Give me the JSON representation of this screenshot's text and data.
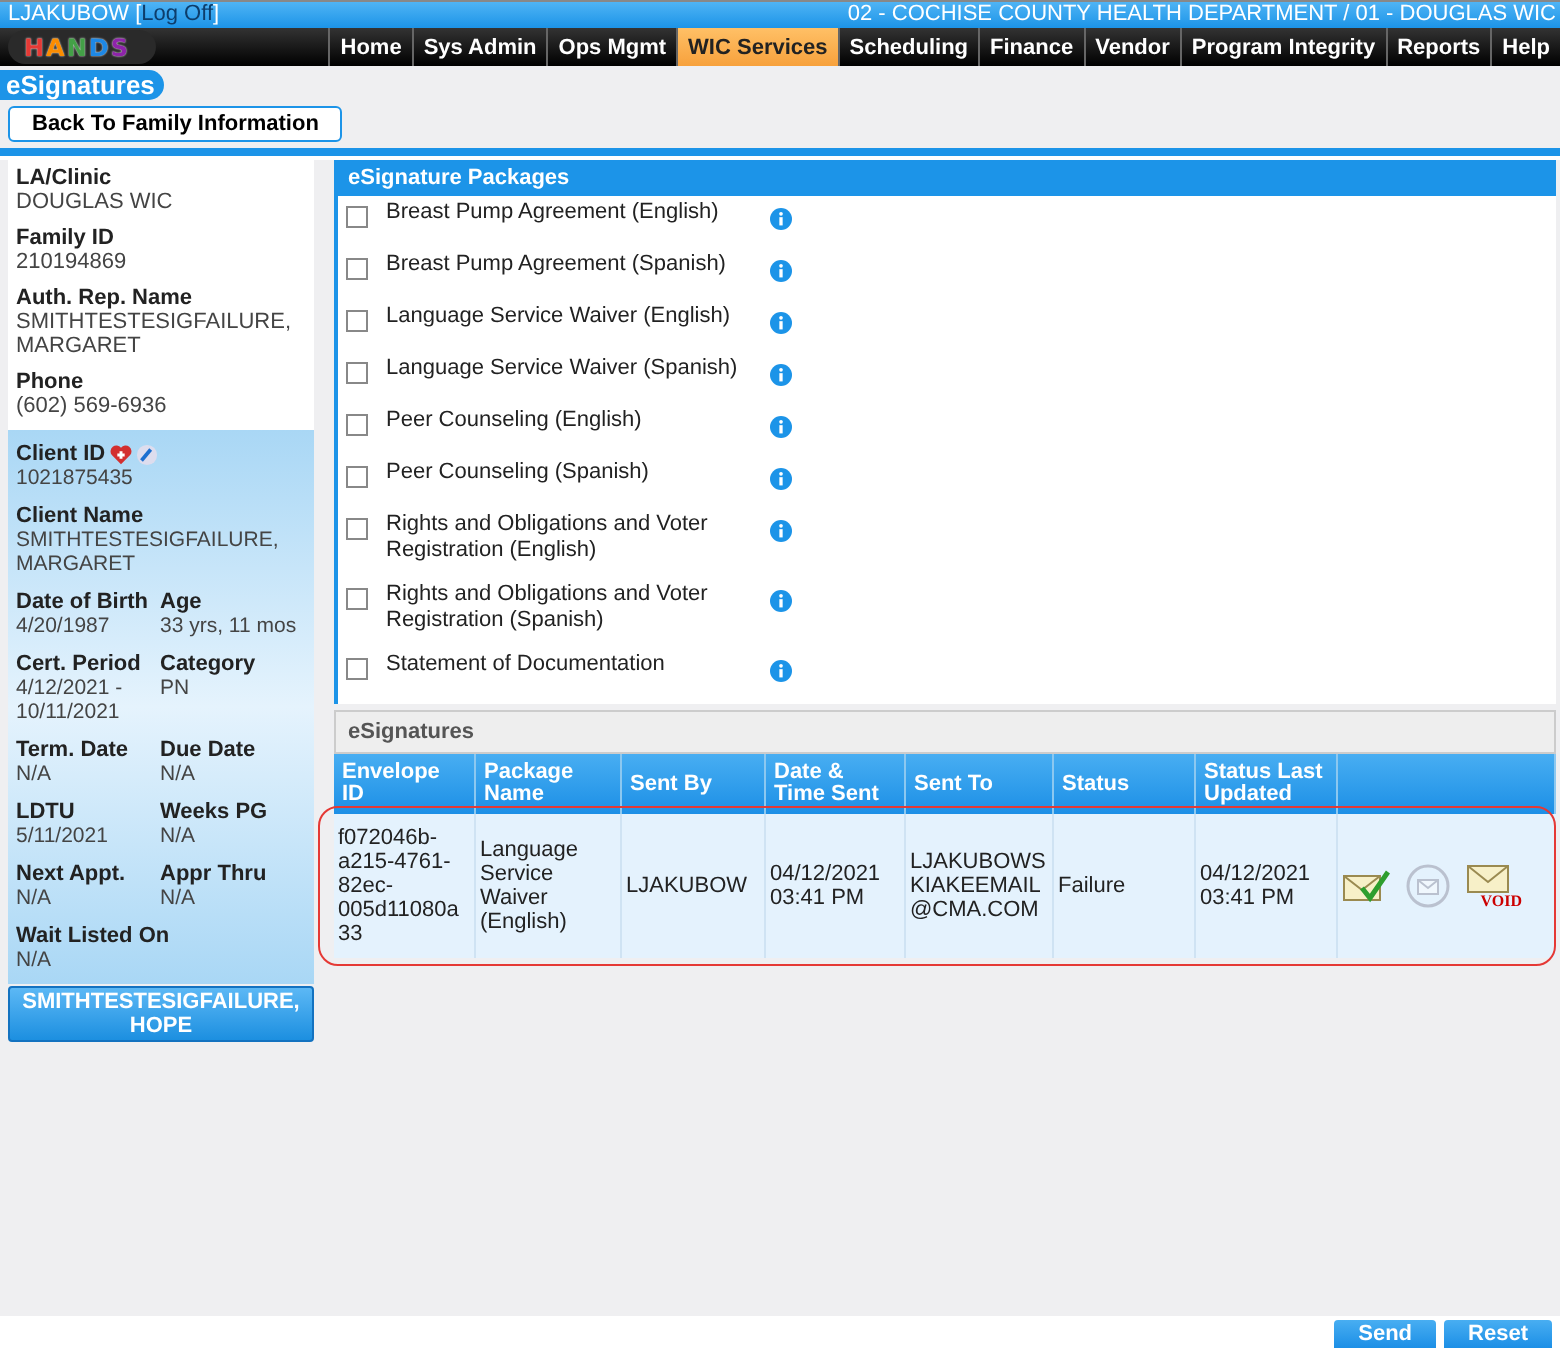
{
  "top_bar": {
    "user": "LJAKUBOW",
    "open_bracket": "[",
    "logoff": "Log Off",
    "close_bracket": "]",
    "organization": "02 - COCHISE COUNTY HEALTH DEPARTMENT / 01 - DOUGLAS WIC"
  },
  "logo": {
    "letters": [
      "H",
      "A",
      "N",
      "D",
      "S"
    ]
  },
  "nav": [
    {
      "label": "Home",
      "selected": false
    },
    {
      "label": "Sys Admin",
      "selected": false
    },
    {
      "label": "Ops Mgmt",
      "selected": false
    },
    {
      "label": "WIC Services",
      "selected": true
    },
    {
      "label": "Scheduling",
      "selected": false
    },
    {
      "label": "Finance",
      "selected": false
    },
    {
      "label": "Vendor",
      "selected": false
    },
    {
      "label": "Program Integrity",
      "selected": false
    },
    {
      "label": "Reports",
      "selected": false
    },
    {
      "label": "Help",
      "selected": false
    }
  ],
  "page_title": "eSignatures",
  "back_button": "Back To Family Information",
  "sidebar": {
    "family_fields": [
      {
        "label": "LA/Clinic",
        "value": "DOUGLAS WIC"
      },
      {
        "label": "Family ID",
        "value": "210194869"
      },
      {
        "label": "Auth. Rep. Name",
        "value": "SMITHTESTESIGFAILURE, MARGARET"
      },
      {
        "label": "Phone",
        "value": "(602) 569-6936"
      }
    ],
    "client_id": {
      "label": "Client ID",
      "value": "1021875435"
    },
    "client_rows": [
      [
        {
          "label": "Client Name",
          "value": "SMITHTESTESIGFAILURE, MARGARET"
        }
      ],
      [
        {
          "label": "Date of Birth",
          "value": "4/20/1987"
        },
        {
          "label": "Age",
          "value": "33 yrs, 11 mos"
        }
      ],
      [
        {
          "label": "Cert. Period",
          "value": "4/12/2021 - 10/11/2021"
        },
        {
          "label": "Category",
          "value": "PN"
        }
      ],
      [
        {
          "label": "Term. Date",
          "value": "N/A"
        },
        {
          "label": "Due Date",
          "value": "N/A"
        }
      ],
      [
        {
          "label": "LDTU",
          "value": "5/11/2021"
        },
        {
          "label": "Weeks PG",
          "value": "N/A"
        }
      ],
      [
        {
          "label": "Next Appt.",
          "value": "N/A"
        },
        {
          "label": "Appr Thru",
          "value": "N/A"
        }
      ],
      [
        {
          "label": "Wait Listed On",
          "value": "N/A"
        }
      ]
    ],
    "other_client": "SMITHTESTESIGFAILURE, HOPE"
  },
  "packages": {
    "title": "eSignature Packages",
    "items": [
      {
        "label": "Breast Pump Agreement (English)",
        "checked": false
      },
      {
        "label": "Breast Pump Agreement (Spanish)",
        "checked": false
      },
      {
        "label": "Language Service Waiver (English)",
        "checked": false
      },
      {
        "label": "Language Service Waiver (Spanish)",
        "checked": false
      },
      {
        "label": "Peer Counseling (English)",
        "checked": false
      },
      {
        "label": "Peer Counseling (Spanish)",
        "checked": false
      },
      {
        "label": "Rights and Obligations and Voter Registration (English)",
        "checked": false
      },
      {
        "label": "Rights and Obligations and Voter Registration (Spanish)",
        "checked": false
      },
      {
        "label": "Statement of Documentation",
        "checked": false
      }
    ]
  },
  "esignatures": {
    "title": "eSignatures",
    "columns": [
      "Envelope ID",
      "Package Name",
      "Sent By",
      "Date & Time Sent",
      "Sent To",
      "Status",
      "Status Last Updated"
    ],
    "rows": [
      {
        "highlighted": true,
        "cells": [
          "f072046b-a215-4761-82ec-005d11080a33",
          "Language Service Waiver (English)",
          "LJAKUBOW",
          "04/12/2021 03:41 PM",
          "LJAKUBOWS KIAKEEMAIL @CMA.COM",
          "Failure",
          "04/12/2021 03:41 PM"
        ],
        "actions": [
          {
            "kind": "check",
            "disabled": false
          },
          {
            "kind": "refresh",
            "disabled": true
          },
          {
            "kind": "void",
            "label": "VOID",
            "disabled": false
          }
        ]
      }
    ]
  },
  "buttons": [
    "Send",
    "Reset"
  ]
}
